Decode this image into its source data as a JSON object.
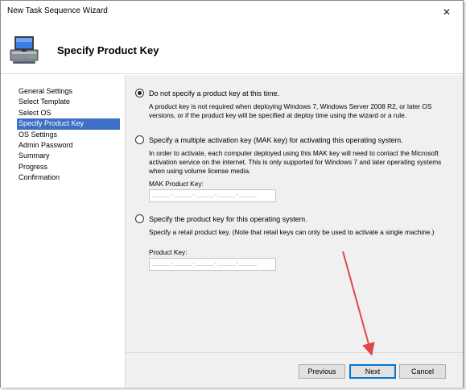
{
  "window": {
    "title": "New Task Sequence Wizard",
    "close_glyph": "✕"
  },
  "header": {
    "title": "Specify Product Key",
    "icon": "computer-icon"
  },
  "nav": {
    "items": [
      "General Settings",
      "Select Template",
      "Select OS",
      "Specify Product Key",
      "OS Settings",
      "Admin Password",
      "Summary",
      "Progress",
      "Confirmation"
    ],
    "active_index": 3
  },
  "options": {
    "no_key": {
      "label": "Do not specify a product key at this time.",
      "description": "A product key is not required when deploying Windows 7, Windows Server 2008 R2, or later OS versions, or if the product key will be specified at deploy time using the wizard or a rule.",
      "checked": true
    },
    "mak": {
      "label": "Specify a multiple activation key (MAK key) for activating this operating system.",
      "description": "In order to activate, each computer deployed using this MAK key will need to contact the Microsoft activation service on the internet.  This is only supported for Windows 7 and later operating systems when using volume license media.",
      "field_label": "MAK Product Key:",
      "field_mask": "_____-_____-_____-_____-_____",
      "checked": false
    },
    "retail": {
      "label": "Specify the product key for this operating system.",
      "description": "Specify a retail product key.  (Note that retail keys can only be used to activate a single machine.)",
      "field_label": "Product Key:",
      "field_mask": "_____-_____-_____-_____-_____",
      "checked": false
    }
  },
  "buttons": {
    "previous": "Previous",
    "next": "Next",
    "cancel": "Cancel"
  },
  "colors": {
    "accent": "#3d6fc4",
    "annotation_arrow": "#e04848",
    "focus_border": "#0078d7"
  }
}
